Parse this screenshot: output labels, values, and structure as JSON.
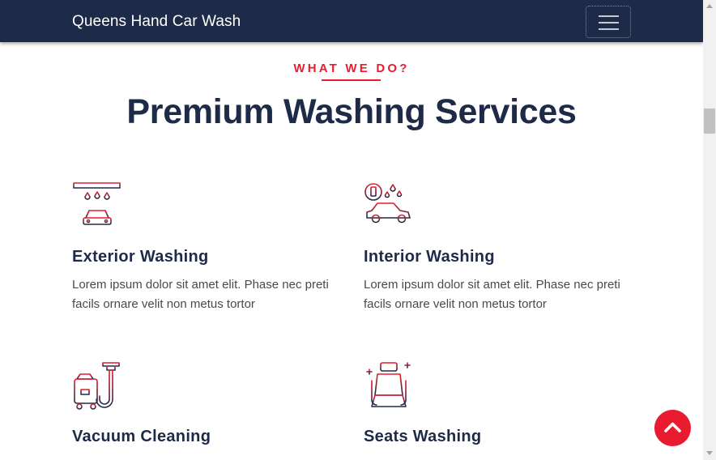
{
  "navbar": {
    "brand": "Queens Hand Car Wash",
    "toggler_icon": "hamburger-menu-icon"
  },
  "section": {
    "subtitle": "WHAT WE DO?",
    "title": "Premium Washing Services"
  },
  "services": [
    {
      "title": "Exterior Washing",
      "text": "Lorem ipsum dolor sit amet elit. Phase nec preti facils ornare velit non metus tortor",
      "icon": "car-wash-icon"
    },
    {
      "title": "Interior Washing",
      "text": "Lorem ipsum dolor sit amet elit. Phase nec preti facils ornare velit non metus tortor",
      "icon": "car-foam-icon"
    },
    {
      "title": "Vacuum Cleaning",
      "text": "",
      "icon": "vacuum-cleaner-icon"
    },
    {
      "title": "Seats Washing",
      "text": "",
      "icon": "car-seat-icon"
    }
  ],
  "scroll_top_icon": "chevron-up-icon",
  "colors": {
    "navbar": "#1d2a48",
    "accent": "#e81c2e",
    "heading": "#1d2a48",
    "body_text": "#4a4a4a"
  }
}
